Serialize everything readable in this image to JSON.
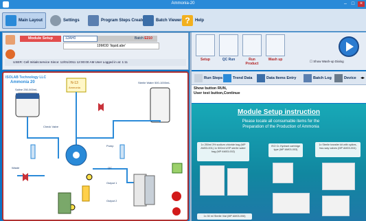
{
  "window": {
    "title": "Ammonia-20"
  },
  "toolbar": {
    "main_layout": "Main Layout",
    "settings": "Settings",
    "program_steps_creator": "Program Steps Creator",
    "batch_viewer": "Batch Viewer",
    "help": "Help"
  },
  "module": {
    "setup_label": "Module Setup",
    "id_value": "12AH0",
    "batch_label": "Batch",
    "batch_value": "E210",
    "description": "19MOD 'liquid.abe'",
    "status": "USER: Cell Initials:service  Since: 12/01/2011 12:00:00 AM  User Logged in at: 1:11"
  },
  "diagram": {
    "company": "ISOLAB Technology LLC",
    "product": "Ammonia 20",
    "source": "N-13",
    "source_sub": "Ammonia",
    "waste_label": "Sterile Water 500-1000mL",
    "saline_label": "Saline 250-500mL",
    "labels": [
      "Check Valve",
      "Waste",
      "Pump",
      "QC",
      "Output 1",
      "Output 2"
    ]
  },
  "steps": [
    {
      "label": "Setup",
      "color": "#b22222"
    },
    {
      "label": "QC Run",
      "color": "#1f4a8a"
    },
    {
      "label": "Run Product",
      "color": "#b22222"
    },
    {
      "label": "Wash up",
      "color": "#b22222"
    }
  ],
  "step_hint": "Show Wash-up Dialog",
  "tabs": {
    "run_steps": "Run Steps",
    "trend_data": "Trend Data",
    "data_items_entry": "Data Items Entry",
    "batch_log": "Batch Log",
    "device": "Device"
  },
  "log": {
    "line1": "Show button RUN,",
    "line2": "User test button,Continue"
  },
  "instruction": {
    "title": "Module Setup instruction",
    "sub1": "Please locate all consumable items for the",
    "sub2": "Preparation of the Production of Ammonia",
    "item1": "1x 250ml 3% sodium chloride bag (MP AM03-001) 1x 500ml USP sterile water bag (MP AM03-002)",
    "item2": "ISO Cr-Hydrant cartridge type (MP AM03-003)",
    "item3": "1x Sterile transfer kit with spikes, two-way valves (MP AM03-004)",
    "item4": "1x 30 ml Sterile Vial (MP AM03-006)"
  },
  "colors": {
    "accent": "#0b74c6",
    "highlight_red": "#d21a1a",
    "panel_border": "#b03030"
  }
}
